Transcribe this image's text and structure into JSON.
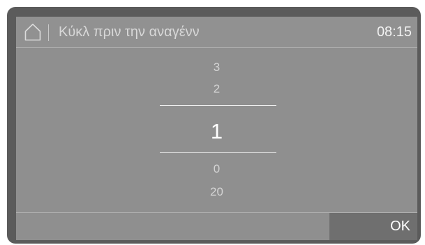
{
  "header": {
    "home_icon": "home-icon",
    "title": "Κύκλ πριν την αναγένν",
    "time": "08:15"
  },
  "picker": {
    "values_above": [
      "3",
      "2"
    ],
    "selected_value": "1",
    "values_below": [
      "0",
      "20"
    ]
  },
  "footer": {
    "ok_label": "OK"
  },
  "colors": {
    "screen_bg": "#8f8f8f",
    "bezel": "#5b5b5b",
    "ok_button_bg": "#6f6f6f",
    "text_primary": "#ffffff",
    "text_secondary": "#d4d4d4"
  }
}
